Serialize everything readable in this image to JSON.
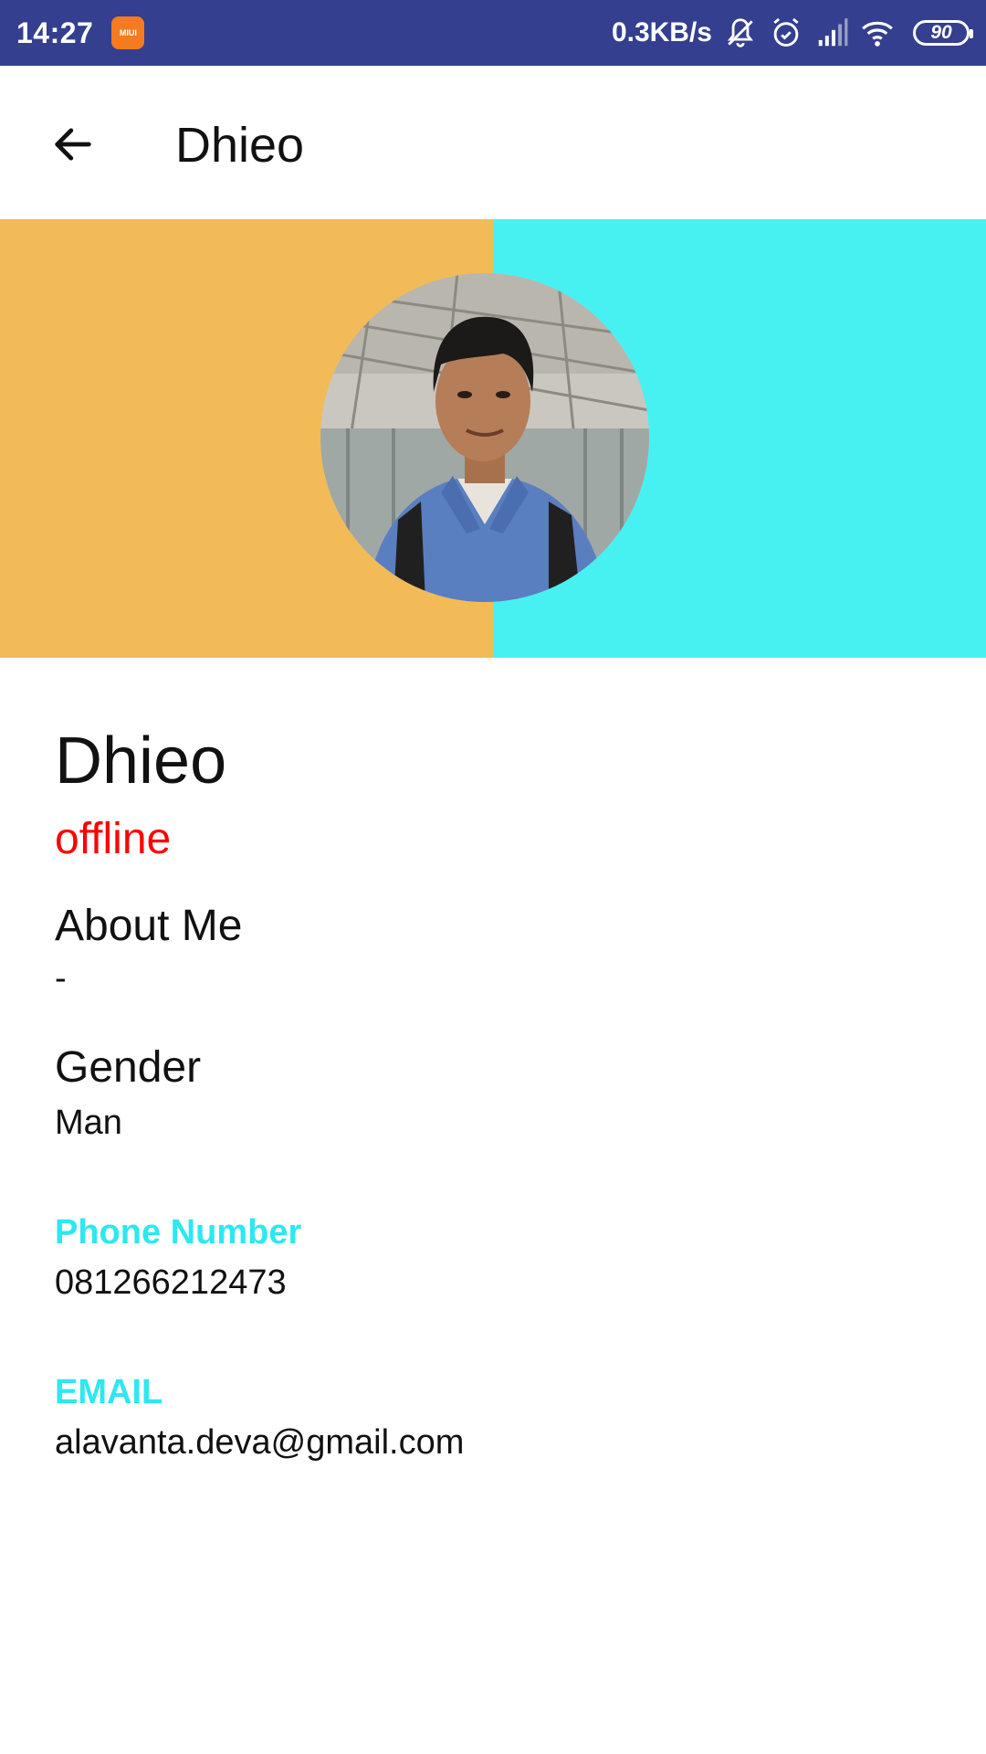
{
  "status_bar": {
    "time": "14:27",
    "miui_badge": "MIUI",
    "net_speed": "0.3KB/s",
    "battery": "90",
    "icons": [
      "notifications-off-icon",
      "alarm-icon",
      "signal-icon",
      "wifi-icon",
      "battery-icon"
    ]
  },
  "app_bar": {
    "back_icon": "arrow-back-icon",
    "title": "Dhieo"
  },
  "banner": {
    "left_color": "#f2bb57",
    "right_color": "#48f1f1",
    "avatar": "profile-photo"
  },
  "profile": {
    "name": "Dhieo",
    "status": "offline",
    "about_label": "About Me",
    "about_value": "-",
    "gender_label": "Gender",
    "gender_value": "Man",
    "phone_label": "Phone Number",
    "phone_value": "081266212473",
    "email_label": "EMAIL",
    "email_value": "alavanta.deva@gmail.com"
  },
  "colors": {
    "status_bar": "#343f8f",
    "offline": "#ff0000",
    "accent": "#2de8f0"
  }
}
